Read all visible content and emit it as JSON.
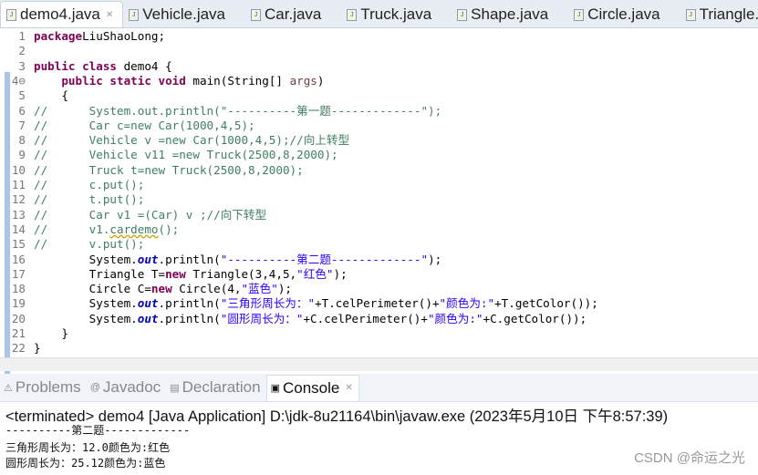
{
  "editor_tabs": [
    {
      "label": "demo4.java",
      "active": true
    },
    {
      "label": "Vehicle.java"
    },
    {
      "label": "Car.java"
    },
    {
      "label": "Truck.java"
    },
    {
      "label": "Shape.java"
    },
    {
      "label": "Circle.java"
    },
    {
      "label": "Triangle.java"
    }
  ],
  "close_glyph": "✕",
  "code": [
    [
      [
        "kw",
        "package"
      ],
      [
        "",
        "LiuShaoLong;"
      ]
    ],
    [],
    [
      [
        "kw",
        "public class"
      ],
      [
        "",
        " demo4 {"
      ]
    ],
    [
      [
        "",
        "    "
      ],
      [
        "kw",
        "public static void"
      ],
      [
        "",
        " main(String[] "
      ],
      [
        "arg",
        "args"
      ],
      [
        "",
        ")"
      ]
    ],
    [
      [
        "",
        "    {"
      ]
    ],
    [
      [
        "cm",
        "//      System.out.println(\"----------第一题-------------\");"
      ]
    ],
    [
      [
        "cm",
        "//      Car c=new Car(1000,4,5);"
      ]
    ],
    [
      [
        "cm",
        "//      Vehicle v =new Car(1000,4,5);//向上转型"
      ]
    ],
    [
      [
        "cm",
        "//      Vehicle v11 =new Truck(2500,8,2000);"
      ]
    ],
    [
      [
        "cm",
        "//      Truck t=new Truck(2500,8,2000);"
      ]
    ],
    [
      [
        "cm",
        "//      c.put();"
      ]
    ],
    [
      [
        "cm",
        "//      t.put();"
      ]
    ],
    [
      [
        "cm",
        "//      Car v1 =(Car) v ;//向下转型"
      ]
    ],
    [
      [
        "cm",
        "//      v1."
      ],
      [
        "mth",
        "cardemo"
      ],
      [
        "cm",
        "();"
      ]
    ],
    [
      [
        "cm",
        "//      v.put();"
      ]
    ],
    [
      [
        "",
        "        System."
      ],
      [
        "fld",
        "out"
      ],
      [
        "",
        ".println("
      ],
      [
        "str",
        "\"----------第二题-------------\""
      ],
      [
        "",
        ");"
      ]
    ],
    [
      [
        "",
        "        Triangle T="
      ],
      [
        "kw",
        "new"
      ],
      [
        "",
        " Triangle(3,4,5,"
      ],
      [
        "str",
        "\"红色\""
      ],
      [
        "",
        ");"
      ]
    ],
    [
      [
        "",
        "        Circle C="
      ],
      [
        "kw",
        "new"
      ],
      [
        "",
        " Circle(4,"
      ],
      [
        "str",
        "\"蓝色\""
      ],
      [
        "",
        ");"
      ]
    ],
    [
      [
        "",
        "        System."
      ],
      [
        "fld",
        "out"
      ],
      [
        "",
        ".println("
      ],
      [
        "str",
        "\"三角形周长为：\""
      ],
      [
        "",
        "+T.celPerimeter()+"
      ],
      [
        "str",
        "\"颜色为:\""
      ],
      [
        "",
        "+T.getColor());"
      ]
    ],
    [
      [
        "",
        "        System."
      ],
      [
        "fld",
        "out"
      ],
      [
        "",
        ".println("
      ],
      [
        "str",
        "\"圆形周长为：\""
      ],
      [
        "",
        "+C.celPerimeter()+"
      ],
      [
        "str",
        "\"颜色为:\""
      ],
      [
        "",
        "+C.getColor());"
      ]
    ],
    [
      [
        "",
        "    }"
      ]
    ],
    [
      [
        "",
        "}"
      ]
    ]
  ],
  "panel_tabs": [
    {
      "label": "Problems"
    },
    {
      "label": "Javadoc"
    },
    {
      "label": "Declaration"
    },
    {
      "label": "Console",
      "active": true
    }
  ],
  "console": {
    "header": "<terminated> demo4 [Java Application] D:\\jdk-8u21164\\bin\\javaw.exe (2023年5月10日 下午8:57:39)",
    "output": [
      "----------第二题-------------",
      "三角形周长为：12.0颜色为:红色",
      "圆形周长为：25.12颜色为:蓝色"
    ]
  },
  "watermark": "CSDN @命运之光"
}
